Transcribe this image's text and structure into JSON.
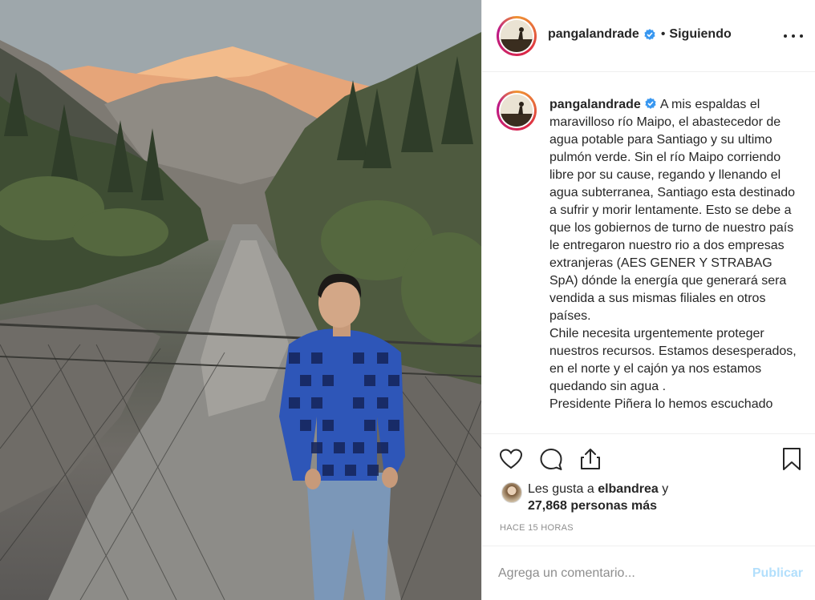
{
  "post": {
    "username": "pangalandrade",
    "separator": "•",
    "follow_status": "Siguiendo",
    "caption": [
      "A mis espaldas el maravilloso río Maipo, el abastecedor de agua potable para Santiago y su ultimo pulmón verde. Sin el río Maipo corriendo libre por su cause, regando y llenando el agua subterranea, Santiago esta destinado a sufrir y morir lentamente. Esto se debe a que los gobiernos de turno de nuestro país le entregaron nuestro rio a dos empresas extranjeras (AES GENER Y STRABAG SpA) dónde la energía que generará sera vendida a sus mismas filiales en otros países.",
      "Chile necesita urgentemente proteger nuestros recursos. Estamos desesperados, en el norte y el cajón ya nos estamos quedando sin agua .",
      "Presidente Piñera lo hemos escuchado"
    ],
    "likes": {
      "prefix": "Les gusta a",
      "liker": "elbandrea",
      "connector": "y",
      "others": "27,868 personas más"
    },
    "timestamp": "HACE 15 HORAS",
    "comment_placeholder": "Agrega un comentario...",
    "publish_label": "Publicar"
  },
  "icons": {
    "verified": "verified-badge-icon",
    "more": "more-options-icon",
    "like": "heart-icon",
    "comment": "comment-bubble-icon",
    "share": "share-icon",
    "save": "bookmark-icon"
  },
  "colors": {
    "verified_blue": "#3897f0",
    "publish_disabled": "#b2dffc",
    "muted_text": "#8e8e8e",
    "border": "#efefef",
    "shirt_blue": "#2e56b8"
  }
}
